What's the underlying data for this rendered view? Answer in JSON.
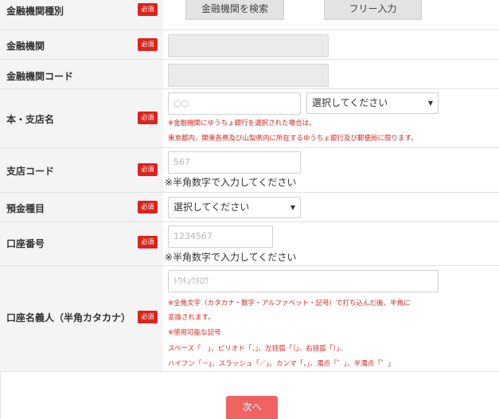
{
  "form": {
    "required_badge": "必須",
    "institution_type": {
      "label": "金融機関種別",
      "search_button": "金融機関を検索",
      "free_input_button": "フリー入力"
    },
    "institution": {
      "label": "金融機関",
      "value": ""
    },
    "institution_code": {
      "label": "金融機関コード",
      "value": ""
    },
    "branch_name": {
      "label": "本・支店名",
      "placeholder": "○○",
      "select_value": "選択してください",
      "note_line1": "※金融機関にゆうちょ銀行を選択された場合は、",
      "note_line2": "東京都内、関東各県及び山梨県内に所在するゆうちょ銀行及び郵便局に限ります。"
    },
    "branch_code": {
      "label": "支店コード",
      "placeholder": "567",
      "hint": "※半角数字で入力してください"
    },
    "deposit_type": {
      "label": "預金種目",
      "select_value": "選択してください"
    },
    "account_number": {
      "label": "口座番号",
      "placeholder": "1234567",
      "hint": "※半角数字で入力してください"
    },
    "account_holder": {
      "label": "口座名義人（半角カタカナ）",
      "placeholder": "ﾄｳｷｮｳﾀﾛｳ",
      "notes": [
        "※全角文字（カタカナ・数字・アルファベット・記号）で打ち込んだ後、半角に",
        "変換されます。",
        "※使用可能な記号",
        "スペース「　」、ピリオド「．」、左括弧「（」、右括弧「）」、",
        "ハイフン「－」、スラッシュ「／」、カンマ「，」、濁点「゛」、半濁点「゜」"
      ]
    },
    "next_button": "次へ"
  }
}
